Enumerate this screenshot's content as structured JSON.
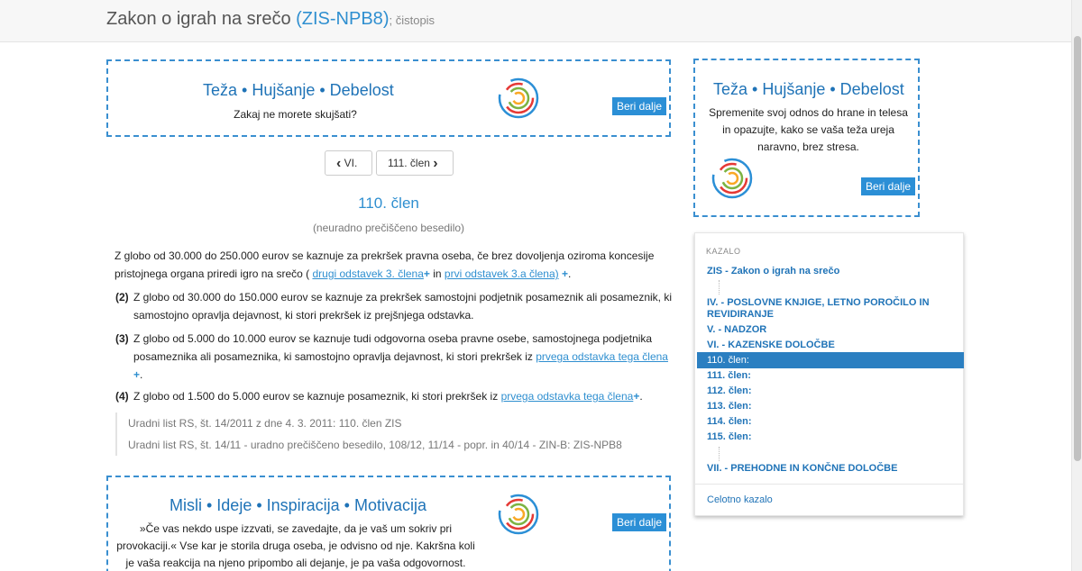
{
  "header": {
    "title": "Zakon o igrah na srečo",
    "code_open": " (",
    "code": "ZIS-NPB8",
    "code_close": ")",
    "subtitle": "; čistopis"
  },
  "ads": {
    "top": {
      "title": "Teža • Hujšanje • Debelost",
      "text": "Zakaj ne morete skujšati?",
      "button": "Beri dalje"
    },
    "side": {
      "title": "Teža • Hujšanje • Debelost",
      "text_lines": [
        "Spremenite svoj odnos do hrane in telesa",
        "in opazujte, kako se vaša teža ureja",
        "naravno, brez stresa."
      ],
      "button": "Beri dalje"
    },
    "bottom": {
      "title": "Misli • Ideje • Inspiracija • Motivacija",
      "text_lines": [
        "»Če vas nekdo uspe izzvati, se zavedajte, da je vaš um sokriv pri",
        "provokaciji.« Vse kar je storila druga oseba, je odvisno od nje. Kakršna koli",
        "je vaša reakcija na njeno pripombo ali dejanje, je pa vaša odgovornost."
      ],
      "button": "Beri dalje"
    }
  },
  "pager": {
    "prev": "VI.",
    "next": "111. člen"
  },
  "article": {
    "title": "110. člen",
    "subtitle": "(neuradno prečiščeno besedilo)",
    "p1": {
      "line1": "Z globo od 30.000 do 250.000 eurov se kaznuje za prekršek pravna oseba, če brez dovoljenja oziroma koncesije",
      "line2_pre": "pristojnega organa priredi igro na srečo (",
      "link1": "drugi odstavek 3. člena",
      "mid": " in ",
      "link2": "prvi odstavek 3.a člena)",
      "end": "."
    },
    "p2": {
      "num": "(2)",
      "line1": "Z globo od 30.000 do 150.000 eurov se kaznuje za prekršek samostojni podjetnik posameznik ali posameznik, ki",
      "line2": "samostojno opravlja dejavnost, ki stori prekršek iz prejšnjega odstavka."
    },
    "p3": {
      "num": "(3)",
      "line1": "Z globo od 5.000 do 10.000 eurov se kaznuje tudi odgovorna oseba pravne osebe, samostojnega podjetnika",
      "line2_pre": "posameznika ali posameznika, ki samostojno opravlja dejavnost, ki stori prekršek iz ",
      "link": "prvega odstavka tega člena",
      "end": "."
    },
    "p4": {
      "num": "(4)",
      "pre": "Z globo od 1.500 do 5.000 eurov se kaznuje posameznik, ki stori prekršek iz ",
      "link": "prvega odstavka tega člena",
      "end": "."
    },
    "sources": [
      "Uradni list RS, št. 14/2011 z dne 4. 3. 2011: 110. člen ZIS",
      "Uradni list RS, št. 14/11 - uradno prečiščeno besedilo, 108/12, 11/14 - popr. in 40/14 - ZIN-B: ZIS-NPB8"
    ]
  },
  "toc": {
    "heading": "KAZALO",
    "root": "ZIS - Zakon o igrah na srečo",
    "ch4_line1": "IV. - POSLOVNE KNJIGE, LETNO POROČILO IN",
    "ch4_line2": "REVIDIRANJE",
    "ch5": "V. - NADZOR",
    "ch6": "VI. - KAZENSKE DOLOČBE",
    "articles": [
      "110. člen:",
      "111. člen:",
      "112. člen:",
      "113. člen:",
      "114. člen:",
      "115. člen:"
    ],
    "ch7": "VII. - PREHODNE IN KONČNE DOLOČBE",
    "full_link": "Celotno kazalo"
  },
  "icons": {
    "logo": "circle-logo-icon",
    "plus": "plus-icon",
    "prev": "chevron-left-icon",
    "next": "chevron-right-icon"
  },
  "colors": {
    "accent": "#2f8fd0",
    "button": "#2b8fd6",
    "toc_active": "#2b7fc1",
    "ad_border": "#3a8fd0"
  }
}
